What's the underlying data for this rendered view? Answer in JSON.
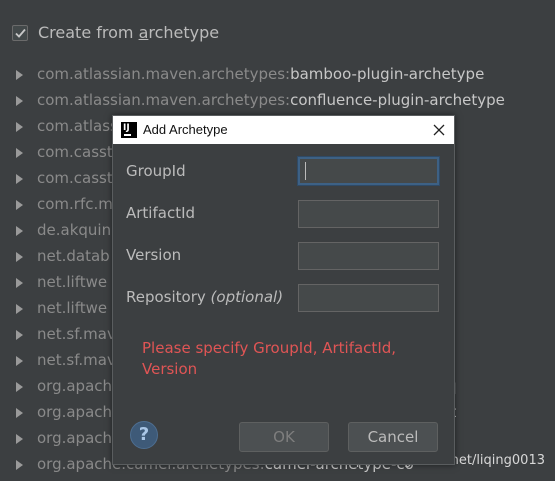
{
  "header": {
    "checkbox_checked": true,
    "checkbox_label_prefix": "Create from ",
    "checkbox_label_mnemonic": "a",
    "checkbox_label_suffix": "rchetype"
  },
  "tree": {
    "items": [
      {
        "group": "com.atlassian.maven.archetypes:",
        "artifact": "bamboo-plugin-archetype"
      },
      {
        "group": "com.atlassian.maven.archetypes:",
        "artifact": "confluence-plugin-archetype"
      },
      {
        "group": "com.atlass",
        "artifact": ""
      },
      {
        "group": "com.casst",
        "artifact": ""
      },
      {
        "group": "com.casst",
        "artifact": ""
      },
      {
        "group": "com.rfc.m",
        "artifact": ""
      },
      {
        "group": "de.akquin",
        "artifact": ""
      },
      {
        "group": "net.datab",
        "artifact": ""
      },
      {
        "group": "net.liftwe",
        "artifact": ""
      },
      {
        "group": "net.liftwe",
        "artifact": ""
      },
      {
        "group": "net.sf.mav",
        "artifact": ""
      },
      {
        "group": "net.sf.mav",
        "artifact": ""
      },
      {
        "group": "org.apach",
        "artifact": "q"
      },
      {
        "group": "org.apach",
        "artifact": "ment"
      },
      {
        "group": "org.apach",
        "artifact": ""
      },
      {
        "group": "org.apache.camel.archetypes:",
        "artifact": "camel-archetype-co"
      }
    ]
  },
  "dialog": {
    "title": "Add Archetype",
    "fields": {
      "group_id": {
        "label": "GroupId",
        "value": ""
      },
      "artifact_id": {
        "label": "ArtifactId",
        "value": ""
      },
      "version": {
        "label": "Version",
        "value": ""
      },
      "repository": {
        "label": "Repository",
        "label_hint": "(optional)",
        "value": ""
      }
    },
    "error_message": "Please specify GroupId, ArtifactId, Version",
    "help_label": "?",
    "ok_label": "OK",
    "cancel_label": "Cancel"
  },
  "watermark": "https://blog.csdn.net/liqing0013",
  "colors": {
    "background": "#3c3f41",
    "error": "#e05555",
    "focus": "#3d6185"
  }
}
